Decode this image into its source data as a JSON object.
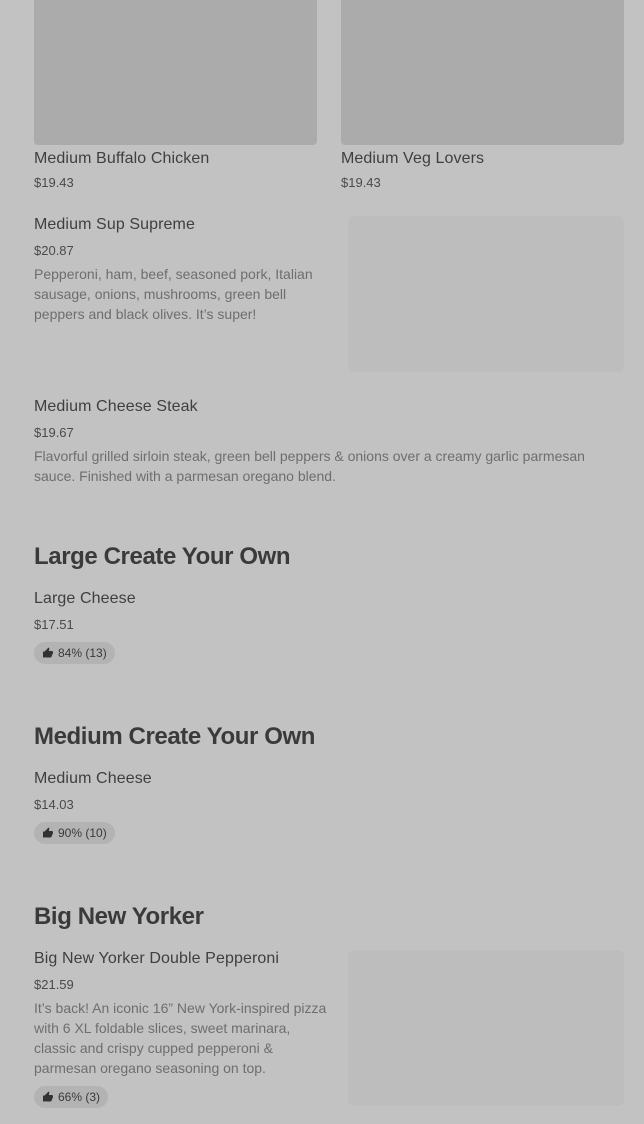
{
  "grid_items": [
    {
      "name": "Medium Buffalo Chicken",
      "price": "$19.43"
    },
    {
      "name": "Medium Veg Lovers",
      "price": "$19.43"
    }
  ],
  "items": {
    "sup_supreme": {
      "name": "Medium Sup Supreme",
      "price": "$20.87",
      "description": "Pepperoni, ham, beef, seasoned pork, Italian sausage, onions, mushrooms, green bell peppers and black olives. It’s super!"
    },
    "cheese_steak": {
      "name": "Medium Cheese Steak",
      "price": "$19.67",
      "description": "Flavorful grilled sirloin steak, green bell peppers & onions over a creamy garlic parmesan sauce. Finished with a parmesan oregano blend."
    },
    "large_cheese": {
      "name": "Large Cheese",
      "price": "$17.51",
      "rating": "84% (13)"
    },
    "medium_cheese": {
      "name": "Medium Cheese",
      "price": "$14.03",
      "rating": "90% (10)"
    },
    "bny_pepperoni": {
      "name": "Big New Yorker Double Pepperoni",
      "price": "$21.59",
      "description": "It’s back! An iconic 16” New York-inspired pizza with 6 XL foldable slices, sweet marinara, classic and crispy cupped pepperoni & parmesan oregano seasoning on top.",
      "rating": "66% (3)"
    }
  },
  "sections": {
    "large_create": "Large Create Your Own",
    "medium_create": "Medium Create Your Own",
    "big_new_yorker": "Big New Yorker"
  },
  "icons": {
    "rating": "thumbs-up-icon"
  },
  "colors": {
    "overlay_bg": "#c2c2c2",
    "text": "#3a3a3a",
    "muted": "#6e6e6e"
  }
}
